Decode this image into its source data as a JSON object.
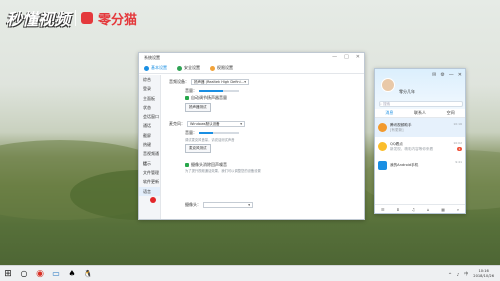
{
  "watermark": {
    "text": "秒懂视频",
    "sub": "零分猫"
  },
  "settings": {
    "title": "系统设置",
    "tabs": [
      "基本设置",
      "安全设置",
      "权限设置"
    ],
    "window_controls": [
      "—",
      "□",
      "✕"
    ],
    "sidebar": [
      "综合",
      "登录",
      "主面板",
      "状态",
      "会话窗口",
      "通话",
      "截屏",
      "热键",
      "音视频通话",
      "提示",
      "文件管理",
      "软件更新",
      "语言"
    ],
    "speaker_label": "音频设备：",
    "speaker_value": "扬声器 (Realtek High Defini...",
    "volume_label": "音量：",
    "auto_adjust": "自动调节扬声器音量",
    "test_speaker": "扬声器测试",
    "mic_label": "麦克风：",
    "mic_value": "Windows默认设备",
    "mic_hint": "调试麦克风音量，请说话测试声音",
    "test_mic": "麦克风测试",
    "noise": "摄像头消除回声噪音",
    "noise_hint": "为了提升视频通话效果，我们可以调整您的设备设置",
    "camera_label": "摄像头：",
    "dropdown_arrow": "▾"
  },
  "qq": {
    "controls": [
      "✉",
      "⚙",
      "—",
      "✕"
    ],
    "nickname": "零分几年",
    "search_placeholder": "搜索",
    "tabs": [
      "消息",
      "联系人",
      "空间"
    ],
    "items": [
      {
        "name": "腾讯视频助手",
        "msg": "[有更新]",
        "time": "10:16",
        "badge": "",
        "color": "#f29a2e"
      },
      {
        "name": "QQ看点",
        "msg": "新发现，精彩内容等你来看",
        "time": "10:02",
        "badge": "1",
        "color": "#fbbe2c"
      },
      {
        "name": "我的Android手机",
        "msg": "",
        "time": "9:41",
        "badge": "",
        "color": "#1a8fe3"
      }
    ],
    "footer_icons": [
      "☰",
      "⬇",
      "♫",
      "⌂",
      "▦",
      "⌕"
    ]
  },
  "taskbar": {
    "start": "⊞",
    "icons": [
      "○",
      "◉",
      "▭",
      "♠",
      "🐧"
    ],
    "time": "10:16",
    "date": "2018/10/26",
    "tray": [
      "^",
      "♪",
      "中"
    ]
  }
}
